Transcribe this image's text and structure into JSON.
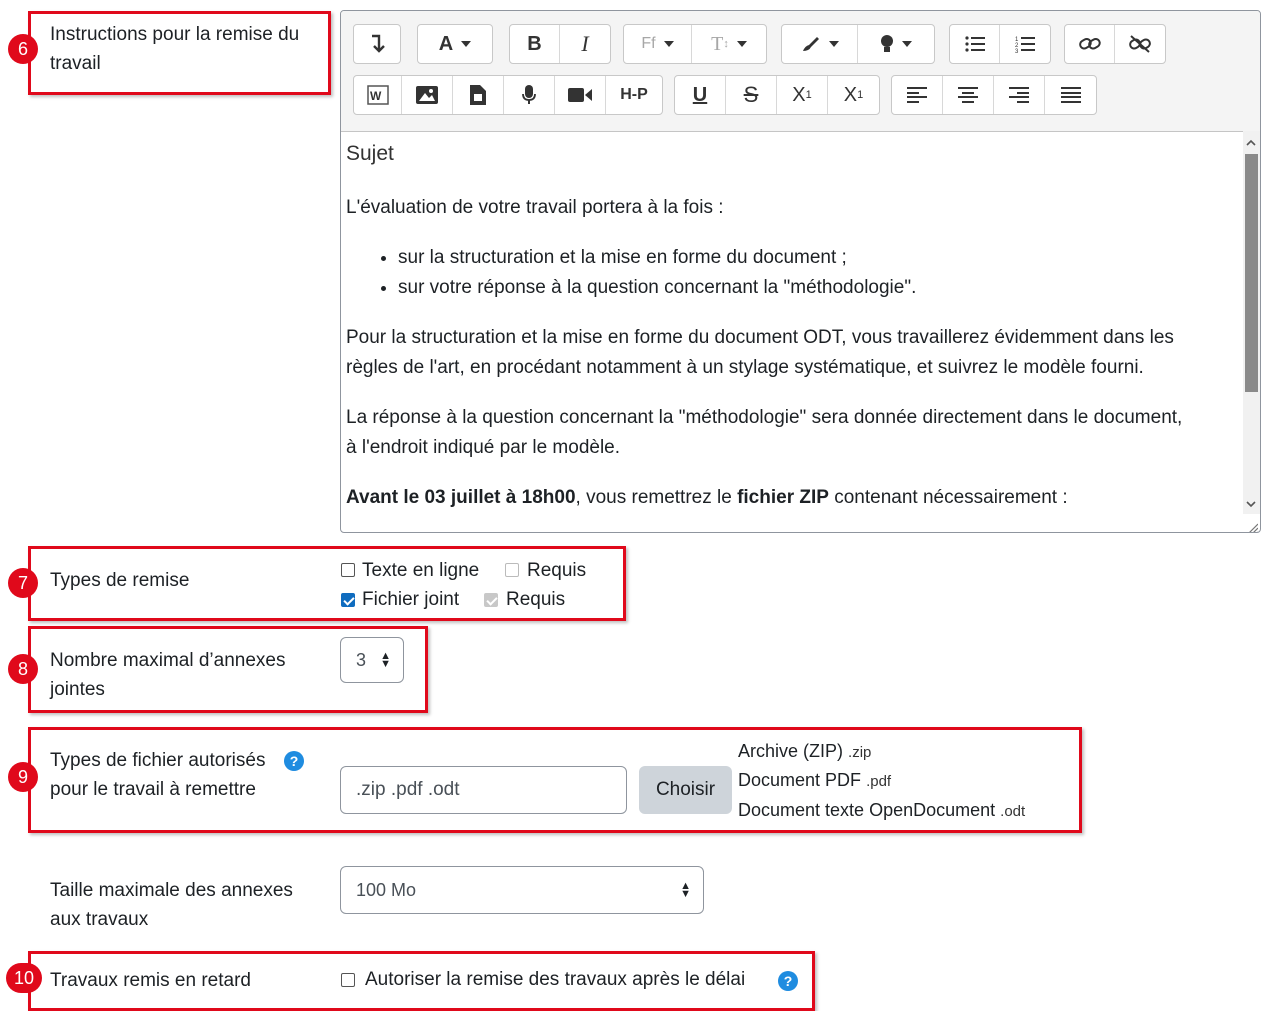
{
  "field6": {
    "number": "6",
    "label": "Instructions pour la remise du travail",
    "toolbar": {
      "row1": [
        "↵",
        "A",
        "B",
        "I",
        "Ff",
        "Tt",
        "brush",
        "bulb",
        "bullets",
        "numbers",
        "link",
        "unlink"
      ],
      "row2": [
        "W",
        "img",
        "file",
        "mic",
        "video",
        "H-P",
        "U",
        "S",
        "X1",
        "X1s",
        "align-left",
        "align-center",
        "align-right",
        "justify"
      ]
    },
    "content": {
      "heading": "Sujet",
      "p1": "L'évaluation de votre travail portera à la fois :",
      "bullets": [
        "sur la structuration et la mise en forme du document ;",
        "sur votre réponse à la question concernant la \"méthodologie\"."
      ],
      "p2_line1": "Pour la structuration et la mise en forme du document ODT, vous travaillerez évidemment dans les",
      "p2_line2": "règles de l'art, en procédant notamment à un stylage systématique, et suivrez le modèle fourni.",
      "p3_line1": "La réponse à la question concernant la \"méthodologie\" sera donnée directement dans le document,",
      "p3_line2": "à l'endroit indiqué par le modèle.",
      "p4_bold1": "Avant le 03 juillet à 18h00",
      "p4_text1": ", vous remettrez le ",
      "p4_bold2": "fichier ZIP",
      "p4_text2": " contenant nécessairement :"
    }
  },
  "field7": {
    "number": "7",
    "label": "Types de remise",
    "options": [
      {
        "label": "Texte en ligne",
        "checked": false,
        "required_label": "Requis",
        "required_checked": false
      },
      {
        "label": "Fichier joint",
        "checked": true,
        "required_label": "Requis",
        "required_checked": true
      }
    ]
  },
  "field8": {
    "number": "8",
    "label_line1": "Nombre maximal d’annexes",
    "label_line2": "jointes",
    "value": "3"
  },
  "field9": {
    "number": "9",
    "label_line1": "Types de fichier autorisés",
    "label_line2": "pour le travail à remettre",
    "help": "?",
    "value": ".zip .pdf .odt",
    "button": "Choisir",
    "types": [
      {
        "name": "Archive (ZIP)",
        "ext": ".zip"
      },
      {
        "name": "Document PDF",
        "ext": ".pdf"
      },
      {
        "name": "Document texte OpenDocument",
        "ext": ".odt"
      }
    ]
  },
  "size": {
    "label_line1": "Taille maximale des annexes",
    "label_line2": "aux travaux",
    "value": "100 Mo"
  },
  "field10": {
    "number": "10",
    "label": "Travaux remis en retard",
    "checkbox_label": "Autoriser la remise des travaux après le délai",
    "help": "?"
  },
  "colors": {
    "annotation_red": "#e0091b",
    "checkbox_blue": "#0f6cbf",
    "help_blue": "#1f8ce0"
  }
}
